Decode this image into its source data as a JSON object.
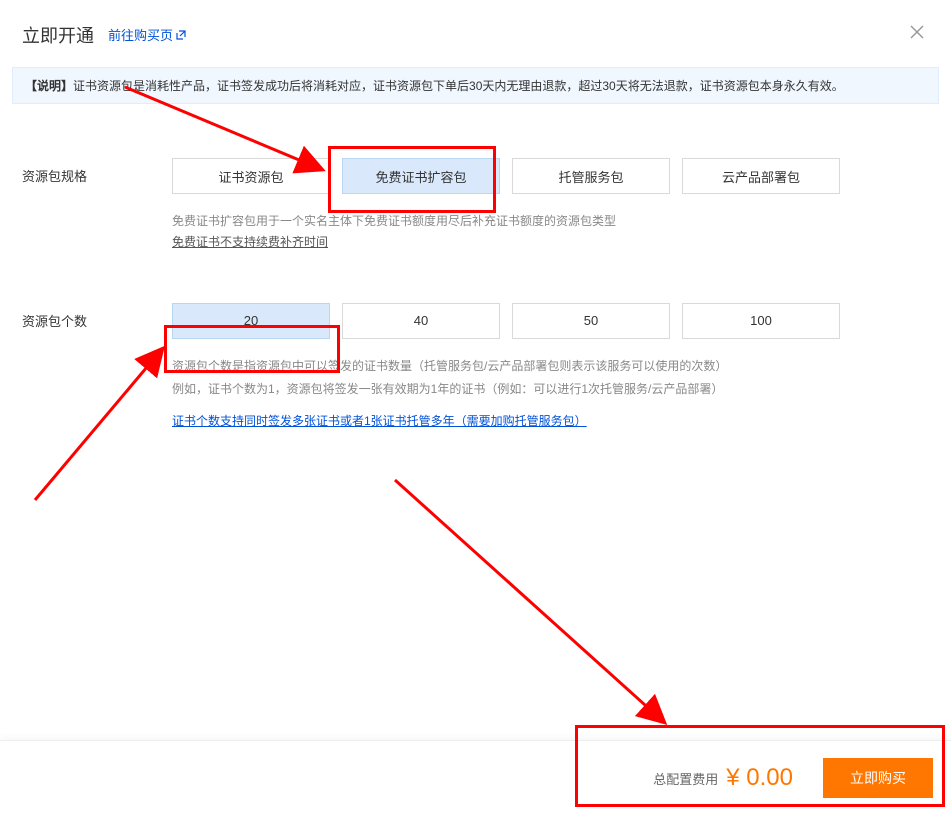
{
  "header": {
    "title": "立即开通",
    "link_text": "前往购买页"
  },
  "notice": {
    "prefix": "【说明】",
    "text": "证书资源包是消耗性产品，证书签发成功后将消耗对应，证书资源包下单后30天内无理由退款，超过30天将无法退款，证书资源包本身永久有效。"
  },
  "spec": {
    "label": "资源包规格",
    "options": [
      "证书资源包",
      "免费证书扩容包",
      "托管服务包",
      "云产品部署包"
    ],
    "selected_index": 1,
    "desc": "免费证书扩容包用于一个实名主体下免费证书额度用尽后补充证书额度的资源包类型",
    "link": "免费证书不支持续费补齐时间"
  },
  "count": {
    "label": "资源包个数",
    "options": [
      "20",
      "40",
      "50",
      "100"
    ],
    "selected_index": 0,
    "desc1": "资源包个数是指资源包中可以签发的证书数量（托管服务包/云产品部署包则表示该服务可以使用的次数）",
    "desc2": "例如，证书个数为1，资源包将签发一张有效期为1年的证书（例如：可以进行1次托管服务/云产品部署）",
    "link": "证书个数支持同时签发多张证书或者1张证书托管多年（需要加购托管服务包）"
  },
  "footer": {
    "fee_label": "总配置费用",
    "fee_amount": "¥ 0.00",
    "buy_label": "立即购买"
  }
}
